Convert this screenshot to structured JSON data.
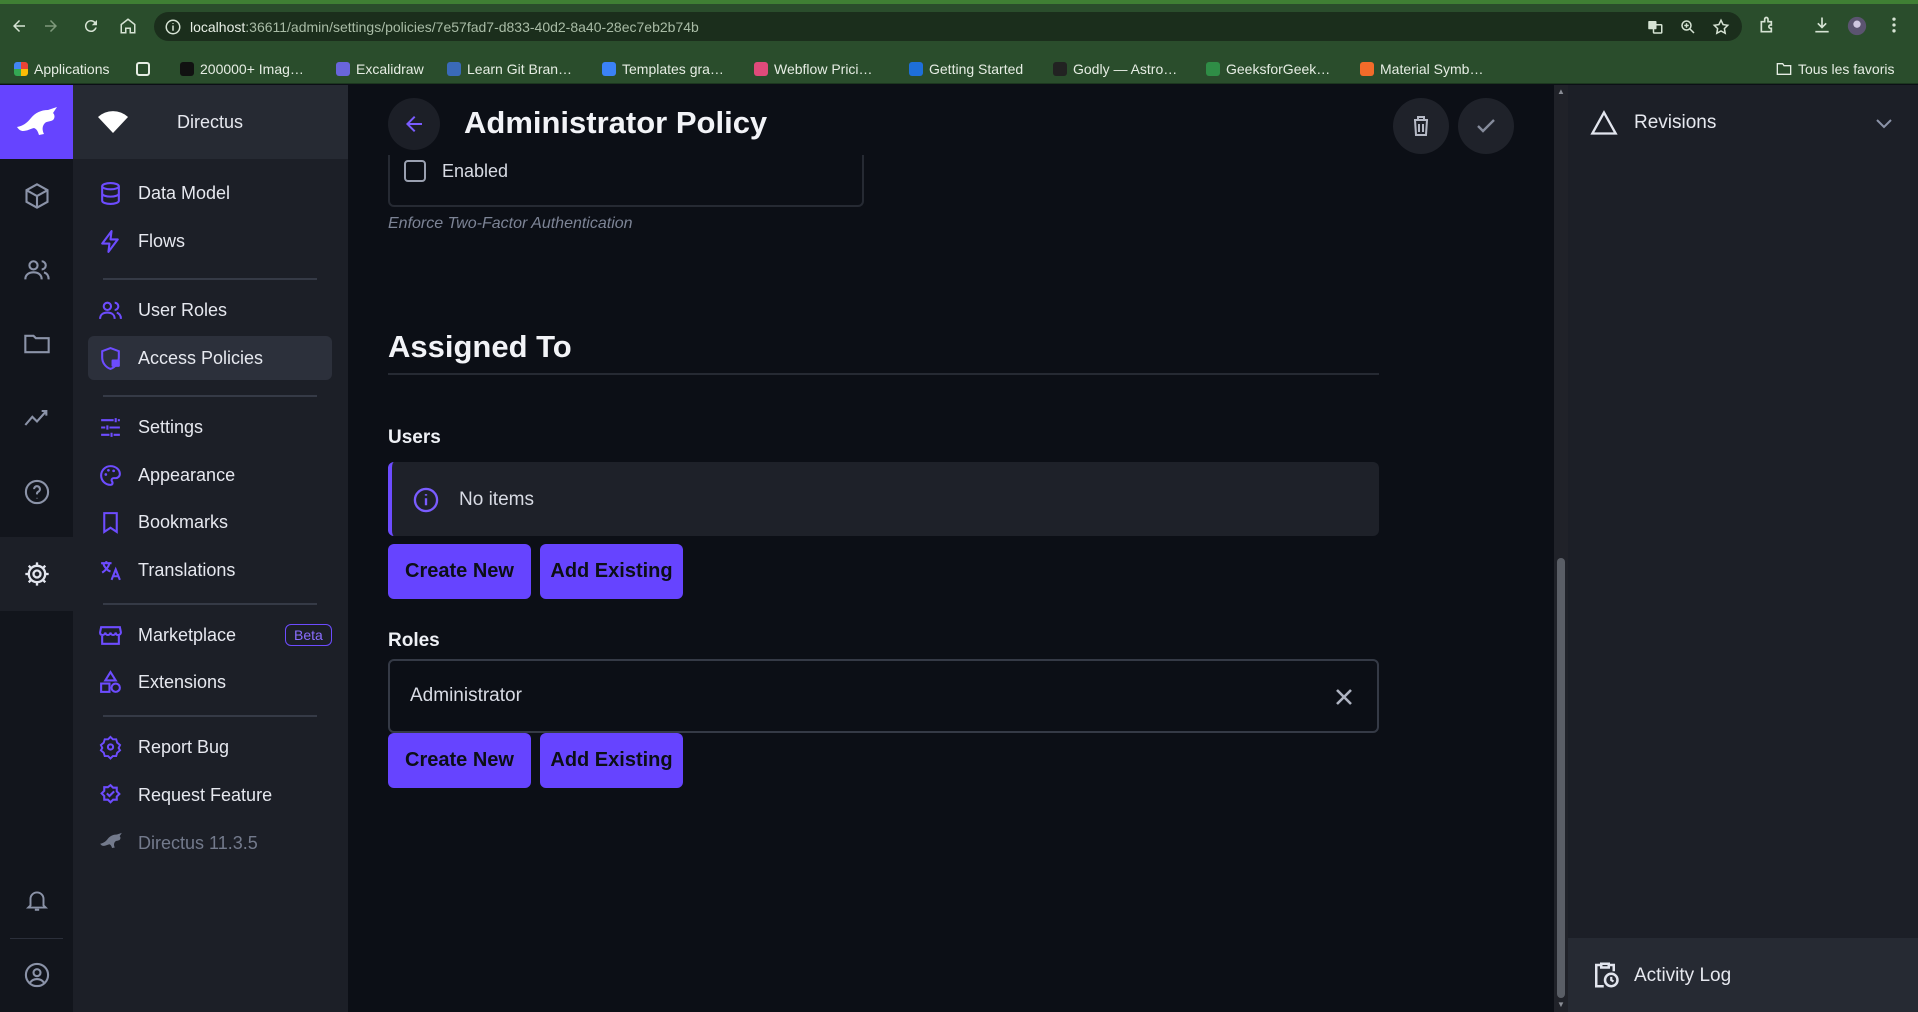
{
  "browser": {
    "url_host": "localhost",
    "url_path": ":36611/admin/settings/policies/7e57fad7-d833-40d2-8a40-28ec7eb2b74b",
    "bookmarks": [
      {
        "label": "Applications",
        "color": "#e8b73a"
      },
      {
        "label": "200000+ Imag…",
        "color": "#111111"
      },
      {
        "label": "Excalidraw",
        "color": "#6965db"
      },
      {
        "label": "Learn Git Bran…",
        "color": "#3a6ab8"
      },
      {
        "label": "Templates gra…",
        "color": "#3b82f6"
      },
      {
        "label": "Webflow Prici…",
        "color": "#e04a7a"
      },
      {
        "label": "Getting Started",
        "color": "#1e6fd9"
      },
      {
        "label": "Godly — Astro…",
        "color": "#222222"
      },
      {
        "label": "GeeksforGeek…",
        "color": "#2f8d46"
      },
      {
        "label": "Material Symb…",
        "color": "#f26b2a"
      }
    ],
    "all_bookmarks_label": "Tous les favoris"
  },
  "project": {
    "name": "Directus"
  },
  "nav": {
    "data_model": "Data Model",
    "flows": "Flows",
    "user_roles": "User Roles",
    "access_policies": "Access Policies",
    "settings": "Settings",
    "appearance": "Appearance",
    "bookmarks": "Bookmarks",
    "translations": "Translations",
    "marketplace": "Marketplace",
    "beta_badge": "Beta",
    "extensions": "Extensions",
    "report_bug": "Report Bug",
    "request_feature": "Request Feature",
    "version": "Directus 11.3.5"
  },
  "page": {
    "title": "Administrator Policy",
    "tfa_checkbox_label": "Enabled",
    "tfa_hint": "Enforce Two-Factor Authentication",
    "assigned_to_title": "Assigned To",
    "users_label": "Users",
    "users_empty": "No items",
    "roles_label": "Roles",
    "roles_items": [
      "Administrator"
    ],
    "create_new_label": "Create New",
    "add_existing_label": "Add Existing"
  },
  "sidebar": {
    "revisions_label": "Revisions",
    "activity_log_label": "Activity Log"
  },
  "colors": {
    "accent": "#6644ff",
    "background": "#0c0f16",
    "nav_background": "#1c1f27"
  }
}
